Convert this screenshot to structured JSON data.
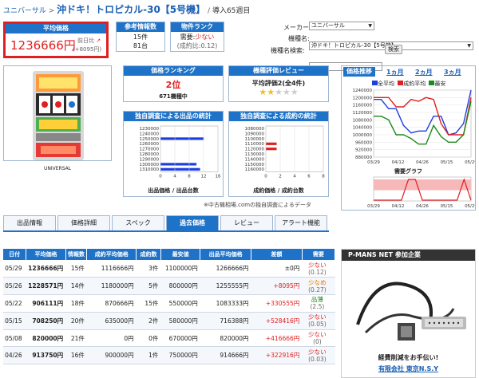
{
  "breadcrumb": {
    "root": "ユニバーサル",
    "sep": ">",
    "title": "沖ドキ！トロピカル-30【5号機】",
    "sep2": "/",
    "weeks": "導入65週目"
  },
  "summary": {
    "avg_price_header": "平均価格",
    "avg_price": "1236666円",
    "prev_label": "前日比",
    "prev_delta": "(+8095円)",
    "ref_header": "参考情報数",
    "ref_1": "15件",
    "ref_2": "81台",
    "rank_header": "物件ランク",
    "rank_demand": "需要:",
    "rank_demand_val": "少ない",
    "rank_ratio": "(成約比:0.12)"
  },
  "search": {
    "maker_label": "メーカー:",
    "maker_value": "ユニバーサル",
    "model_label": "機種名:",
    "model_value": "沖ドキ！トロピカル-30【5号機】",
    "keyword_label": "機種名検索:",
    "keyword_value": "",
    "search_btn": "検索"
  },
  "machine_caption": "UNIVERSAL",
  "ranking": {
    "header": "価格ランキング",
    "rank": "2位",
    "total": "671機種中"
  },
  "review": {
    "header": "機種評価レビュー",
    "text": "平均評価2(全4件)",
    "stars": 2
  },
  "stats_out": {
    "header": "独自調査による出品の統計",
    "caption": "出品価格 / 出品台数"
  },
  "stats_deal": {
    "header": "独自調査による成約の統計",
    "caption": "成約価格 / 成約台数"
  },
  "stats_note": "※中古機相場.comの独自調査によるデータ",
  "trend": {
    "header": "価格推移",
    "ranges": [
      "1ヵ月",
      "2ヵ月",
      "3ヵ月"
    ],
    "legend": [
      "全平均",
      "成約平均",
      "最安"
    ],
    "demand_caption": "需要グラフ"
  },
  "colors": {
    "blue": "#1e73c8",
    "red": "#e02020",
    "green": "#1a8a1a"
  },
  "chart_data": [
    {
      "type": "bar",
      "title": "独自調査による出品の統計",
      "xlabel": "出品台数",
      "ylabel": "出品価格",
      "categories": [
        "1230000",
        "1240000",
        "1250000",
        "1260000",
        "1270000",
        "1280000",
        "1290000",
        "1300000",
        "1310000"
      ],
      "values": [
        0,
        0,
        12,
        0,
        0,
        0,
        0,
        10,
        11
      ],
      "xlim": [
        0,
        12
      ],
      "x_ticks": [
        "0",
        "4",
        "8",
        "12",
        "16"
      ]
    },
    {
      "type": "bar",
      "title": "独自調査による成約の統計",
      "xlabel": "成約台数",
      "ylabel": "成約価格",
      "categories": [
        "1080000",
        "1090000",
        "1100000",
        "1110000",
        "1120000",
        "1130000",
        "1140000",
        "1150000",
        "1160000"
      ],
      "values": [
        0,
        0,
        0,
        2,
        2,
        0,
        0,
        0,
        0
      ],
      "xlim": [
        0,
        8
      ],
      "x_ticks": [
        "0",
        "2",
        "4",
        "6",
        "8"
      ]
    },
    {
      "type": "line",
      "title": "価格推移",
      "x": [
        "03/29",
        "04/12",
        "04/26",
        "05/15",
        "05/29"
      ],
      "ylim": [
        880000,
        1240000
      ],
      "y_ticks": [
        "880000",
        "920000",
        "960000",
        "1000000",
        "1040000",
        "1080000",
        "1120000",
        "1160000",
        "1200000",
        "1240000"
      ],
      "series": [
        {
          "name": "全平均",
          "values": [
            1190000,
            1190000,
            1140000,
            1140000,
            1050000,
            1010000,
            1020000,
            1020000,
            1100000,
            1100000,
            1000000,
            1010000,
            1060000,
            1240000
          ]
        },
        {
          "name": "成約平均",
          "values": [
            1200000,
            1200000,
            1200000,
            1150000,
            1150000,
            1190000,
            1180000,
            1200000,
            1190000,
            1060000,
            1000000,
            1000000,
            1000000,
            1200000
          ]
        },
        {
          "name": "最安",
          "values": [
            1100000,
            1100000,
            1080000,
            1000000,
            1000000,
            980000,
            950000,
            950000,
            1050000,
            990000,
            960000,
            960000,
            1000000,
            1180000
          ]
        }
      ]
    },
    {
      "type": "line",
      "title": "需要グラフ",
      "x": [
        "03/29",
        "04/12",
        "04/26",
        "05/15",
        "05/29"
      ],
      "ylim": [
        0,
        1
      ],
      "series": [
        {
          "name": "需要",
          "values": [
            0,
            0,
            0,
            0,
            0,
            1,
            1,
            0,
            0,
            0,
            0,
            0,
            0,
            1,
            0
          ]
        }
      ]
    }
  ],
  "tabs": [
    "出品情報",
    "価格詳細",
    "スペック",
    "過去価格",
    "レビュー",
    "アラート機能"
  ],
  "table": {
    "headers": [
      "日付",
      "平均価格",
      "情報数",
      "成約平均価格",
      "成約数",
      "最安値",
      "出品平均価格",
      "差額",
      "需要"
    ],
    "rows": [
      [
        "05/29",
        "1236666円",
        "15件",
        "1116666円",
        "3件",
        "1100000円",
        "1266666円",
        "±0円",
        "少ない",
        "(0.12)",
        "red"
      ],
      [
        "05/26",
        "1228571円",
        "14件",
        "1180000円",
        "5件",
        "800000円",
        "1255555円",
        "+8095円",
        "少なめ",
        "(0.27)",
        "orange"
      ],
      [
        "05/22",
        "906111円",
        "18件",
        "870666円",
        "15件",
        "550000円",
        "1083333円",
        "+330555円",
        "品薄",
        "(2.5)",
        "green"
      ],
      [
        "05/15",
        "708250円",
        "20件",
        "635000円",
        "2件",
        "580000円",
        "716388円",
        "+528416円",
        "少ない",
        "(0.05)",
        "red"
      ],
      [
        "05/08",
        "820000円",
        "21件",
        "0円",
        "0件",
        "670000円",
        "820000円",
        "+416666円",
        "少ない",
        "(0)",
        "red"
      ],
      [
        "04/26",
        "913750円",
        "16件",
        "900000円",
        "1件",
        "750000円",
        "914666円",
        "+322916円",
        "少ない",
        "(0.03)",
        "red"
      ]
    ]
  },
  "ad": {
    "header": "P-MANS NET 参加企業",
    "caption": "経費削減をお手伝い!",
    "company": "有限会社 東京N.S.Y"
  }
}
